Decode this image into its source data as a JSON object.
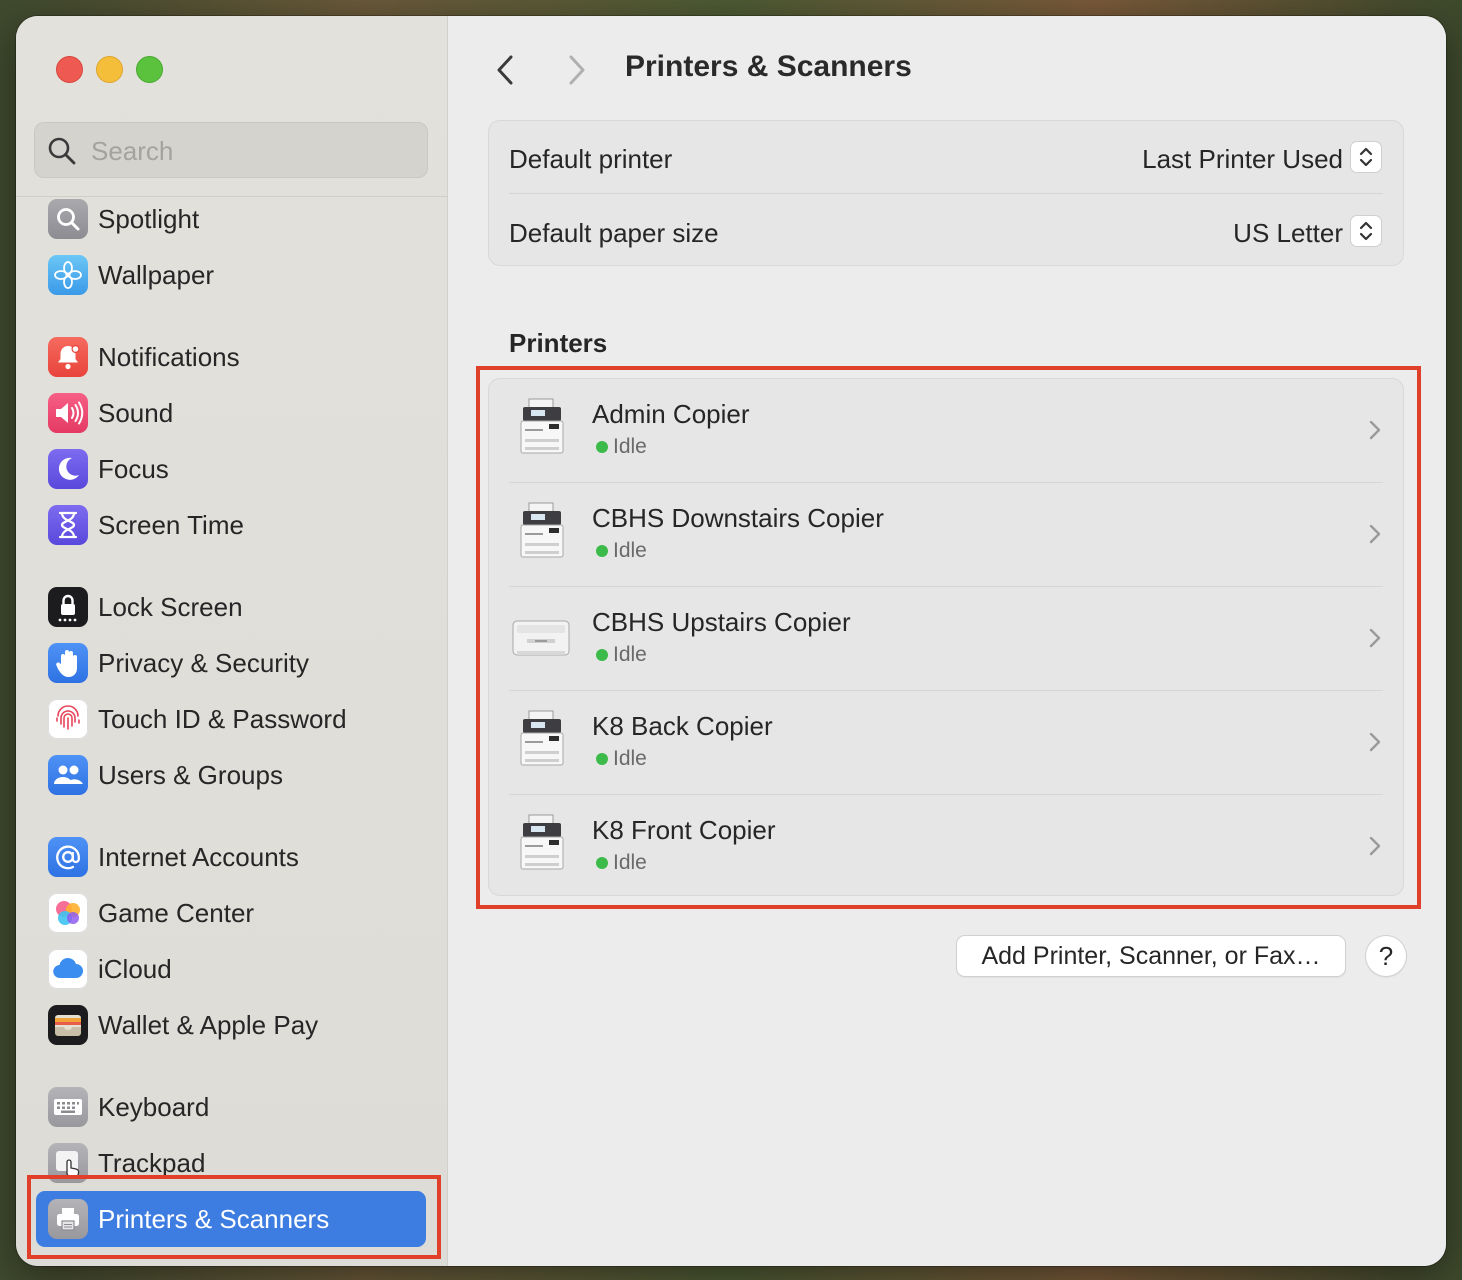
{
  "window": {
    "title": "Printers & Scanners"
  },
  "search": {
    "placeholder": "Search"
  },
  "sidebar": {
    "items": [
      {
        "label": "Spotlight",
        "icon": "magnifier-icon"
      },
      {
        "label": "Wallpaper",
        "icon": "flower-icon"
      },
      {
        "label": "Notifications",
        "icon": "bell-icon"
      },
      {
        "label": "Sound",
        "icon": "speaker-icon"
      },
      {
        "label": "Focus",
        "icon": "moon-icon"
      },
      {
        "label": "Screen Time",
        "icon": "hourglass-icon"
      },
      {
        "label": "Lock Screen",
        "icon": "lock-icon"
      },
      {
        "label": "Privacy & Security",
        "icon": "hand-icon"
      },
      {
        "label": "Touch ID & Password",
        "icon": "fingerprint-icon"
      },
      {
        "label": "Users & Groups",
        "icon": "users-icon"
      },
      {
        "label": "Internet Accounts",
        "icon": "at-icon"
      },
      {
        "label": "Game Center",
        "icon": "game-center-icon"
      },
      {
        "label": "iCloud",
        "icon": "cloud-icon"
      },
      {
        "label": "Wallet & Apple Pay",
        "icon": "wallet-icon"
      },
      {
        "label": "Keyboard",
        "icon": "keyboard-icon"
      },
      {
        "label": "Trackpad",
        "icon": "trackpad-icon"
      },
      {
        "label": "Printers & Scanners",
        "icon": "printer-icon",
        "active": true
      }
    ]
  },
  "header": {
    "title": "Printers & Scanners"
  },
  "defaults": {
    "printer_label": "Default printer",
    "printer_value": "Last Printer Used",
    "paper_label": "Default paper size",
    "paper_value": "US Letter"
  },
  "printers": {
    "section_title": "Printers",
    "items": [
      {
        "name": "Admin Copier",
        "status": "Idle",
        "icon": "copier-icon"
      },
      {
        "name": "CBHS Downstairs Copier",
        "status": "Idle",
        "icon": "copier-icon"
      },
      {
        "name": "CBHS Upstairs Copier",
        "status": "Idle",
        "icon": "laser-printer-icon"
      },
      {
        "name": "K8 Back Copier",
        "status": "Idle",
        "icon": "copier-icon"
      },
      {
        "name": "K8 Front Copier",
        "status": "Idle",
        "icon": "copier-icon"
      }
    ]
  },
  "actions": {
    "add_label": "Add Printer, Scanner, or Fax…",
    "help_label": "?"
  },
  "colors": {
    "accent": "#3d7ce0",
    "status_idle": "#3dbb4a",
    "annotation": "#e0402a"
  }
}
